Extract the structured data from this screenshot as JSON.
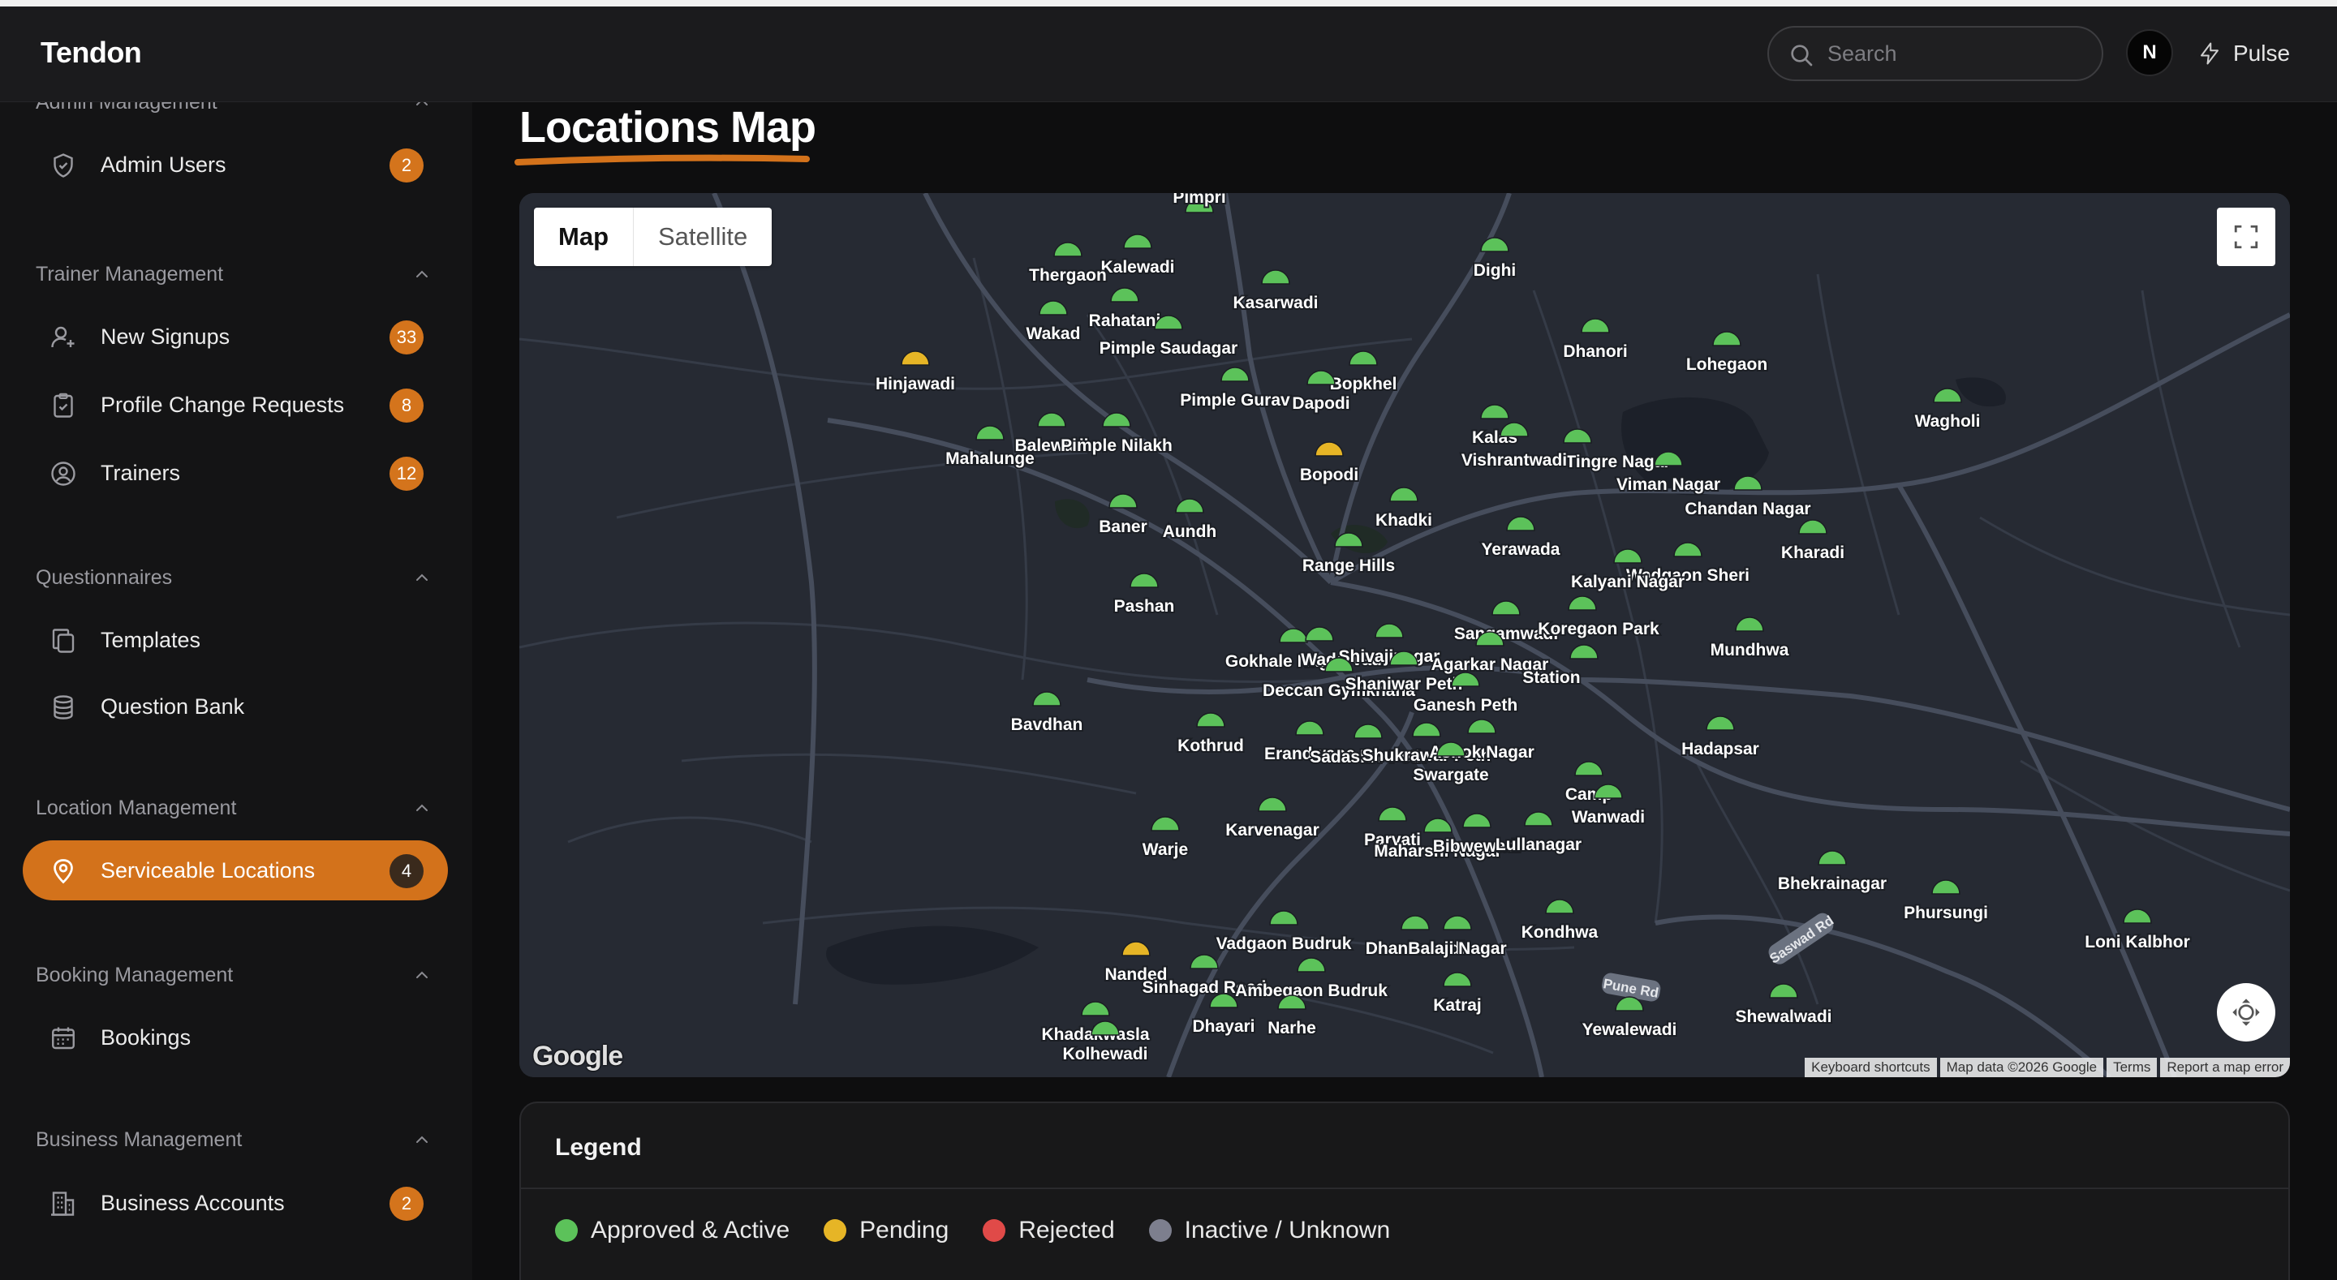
{
  "app": {
    "brand": "Tendon"
  },
  "header": {
    "search_placeholder": "Search",
    "avatar_initial": "N",
    "pulse_label": "Pulse"
  },
  "sidebar": {
    "sections": [
      {
        "title": "Admin Management",
        "items": [
          {
            "label": "Admin Users",
            "badge": "2",
            "icon": "shield-check-icon"
          }
        ]
      },
      {
        "title": "Trainer Management",
        "items": [
          {
            "label": "New Signups",
            "badge": "33",
            "icon": "user-plus-icon"
          },
          {
            "label": "Profile Change Requests",
            "badge": "8",
            "icon": "clipboard-check-icon"
          },
          {
            "label": "Trainers",
            "badge": "12",
            "icon": "user-circle-icon"
          }
        ]
      },
      {
        "title": "Questionnaires",
        "items": [
          {
            "label": "Templates",
            "icon": "copy-icon"
          },
          {
            "label": "Question Bank",
            "icon": "database-icon"
          }
        ]
      },
      {
        "title": "Location Management",
        "items": [
          {
            "label": "Serviceable Locations",
            "badge": "4",
            "icon": "map-pin-icon",
            "active": true
          }
        ]
      },
      {
        "title": "Booking Management",
        "items": [
          {
            "label": "Bookings",
            "icon": "calendar-icon"
          }
        ]
      },
      {
        "title": "Business Management",
        "items": [
          {
            "label": "Business Accounts",
            "badge": "2",
            "icon": "building-icon"
          }
        ]
      }
    ]
  },
  "main": {
    "title": "Locations Map",
    "map": {
      "type_map": "Map",
      "type_satellite": "Satellite",
      "google_logo": "Google",
      "attribution": [
        "Keyboard shortcuts",
        "Map data ©2026 Google",
        "Terms",
        "Report a map error"
      ],
      "markers": [
        {
          "name": "Pimpri",
          "status": "approved"
        },
        {
          "name": "Kalewadi",
          "status": "approved"
        },
        {
          "name": "Thergaon",
          "status": "approved"
        },
        {
          "name": "Dighi",
          "status": "approved"
        },
        {
          "name": "Kasarwadi",
          "status": "approved"
        },
        {
          "name": "Rahatani",
          "status": "approved"
        },
        {
          "name": "Wakad",
          "status": "approved"
        },
        {
          "name": "Pimple Saudagar",
          "status": "approved"
        },
        {
          "name": "Dhanori",
          "status": "approved"
        },
        {
          "name": "Lohegaon",
          "status": "approved"
        },
        {
          "name": "Hinjawadi",
          "status": "pending"
        },
        {
          "name": "Bopkhel",
          "status": "approved"
        },
        {
          "name": "Pimple Gurav",
          "status": "approved"
        },
        {
          "name": "Dapodi",
          "status": "approved"
        },
        {
          "name": "Wagholi",
          "status": "approved"
        },
        {
          "name": "Balewadi",
          "status": "approved"
        },
        {
          "name": "Pimple Nilakh",
          "status": "approved"
        },
        {
          "name": "Kalas",
          "status": "approved"
        },
        {
          "name": "Mahalunge",
          "status": "approved"
        },
        {
          "name": "Tingre Nagar",
          "status": "approved"
        },
        {
          "name": "Vishrantwadi",
          "status": "approved"
        },
        {
          "name": "Bopodi",
          "status": "pending"
        },
        {
          "name": "Viman Nagar",
          "status": "approved"
        },
        {
          "name": "Chandan Nagar",
          "status": "approved"
        },
        {
          "name": "Khadki",
          "status": "approved"
        },
        {
          "name": "Baner",
          "status": "approved"
        },
        {
          "name": "Aundh",
          "status": "approved"
        },
        {
          "name": "Yerawada",
          "status": "approved"
        },
        {
          "name": "Kharadi",
          "status": "approved"
        },
        {
          "name": "Range Hills",
          "status": "approved"
        },
        {
          "name": "Wadgaon Sheri",
          "status": "approved"
        },
        {
          "name": "Kalyani Nagar",
          "status": "approved"
        },
        {
          "name": "Pashan",
          "status": "approved"
        },
        {
          "name": "Sangamwadi",
          "status": "approved"
        },
        {
          "name": "Koregaon Park",
          "status": "approved"
        },
        {
          "name": "Mundhwa",
          "status": "approved"
        },
        {
          "name": "Gokhale Nagar",
          "status": "approved"
        },
        {
          "name": "Wadarvadi",
          "status": "approved"
        },
        {
          "name": "Shivajinagar",
          "status": "approved"
        },
        {
          "name": "Agarkar Nagar",
          "status": "approved"
        },
        {
          "name": "Station",
          "status": "approved"
        },
        {
          "name": "Deccan Gymkhana",
          "status": "approved"
        },
        {
          "name": "Shaniwar Peth",
          "status": "approved"
        },
        {
          "name": "Bavdhan",
          "status": "approved"
        },
        {
          "name": "Ganesh Peth",
          "status": "approved"
        },
        {
          "name": "Hadapsar",
          "status": "approved"
        },
        {
          "name": "Kothrud",
          "status": "approved"
        },
        {
          "name": "Erandwane",
          "status": "approved"
        },
        {
          "name": "Sadashiv Peth",
          "status": "approved"
        },
        {
          "name": "Shukrawar Peth",
          "status": "approved"
        },
        {
          "name": "Ashok Nagar",
          "status": "approved"
        },
        {
          "name": "Swargate",
          "status": "approved"
        },
        {
          "name": "Camp",
          "status": "approved"
        },
        {
          "name": "Wanwadi",
          "status": "approved"
        },
        {
          "name": "Karvenagar",
          "status": "approved"
        },
        {
          "name": "Warje",
          "status": "approved"
        },
        {
          "name": "Parvati",
          "status": "approved"
        },
        {
          "name": "Maharshi Nagar",
          "status": "approved"
        },
        {
          "name": "Bibwewadi",
          "status": "approved"
        },
        {
          "name": "Lullanagar",
          "status": "approved"
        },
        {
          "name": "Bhekrainagar",
          "status": "approved"
        },
        {
          "name": "Phursungi",
          "status": "approved"
        },
        {
          "name": "Loni Kalbhor",
          "status": "approved"
        },
        {
          "name": "Vadgaon Budruk",
          "status": "approved"
        },
        {
          "name": "Dhankawadi",
          "status": "approved"
        },
        {
          "name": "Balaji Nagar",
          "status": "approved"
        },
        {
          "name": "Kondhwa",
          "status": "approved"
        },
        {
          "name": "Nanded",
          "status": "pending"
        },
        {
          "name": "Sinhagad Road",
          "status": "approved"
        },
        {
          "name": "Ambegaon Budruk",
          "status": "approved"
        },
        {
          "name": "Katraj",
          "status": "approved"
        },
        {
          "name": "Shewalwadi",
          "status": "approved"
        },
        {
          "name": "Dhayari",
          "status": "approved"
        },
        {
          "name": "Narhe",
          "status": "approved"
        },
        {
          "name": "Yewalewadi",
          "status": "approved"
        },
        {
          "name": "Khadakwasla",
          "status": "approved"
        },
        {
          "name": "Kolhewadi",
          "status": "approved"
        }
      ],
      "road_labels": [
        "Saswad Rd",
        "Pune Rd"
      ]
    },
    "legend": {
      "title": "Legend",
      "items": [
        {
          "label": "Approved & Active",
          "color": "#5cc25a"
        },
        {
          "label": "Pending",
          "color": "#e6b526"
        },
        {
          "label": "Rejected",
          "color": "#e04a48"
        },
        {
          "label": "Inactive / Unknown",
          "color": "#7d7f8e"
        }
      ]
    }
  }
}
